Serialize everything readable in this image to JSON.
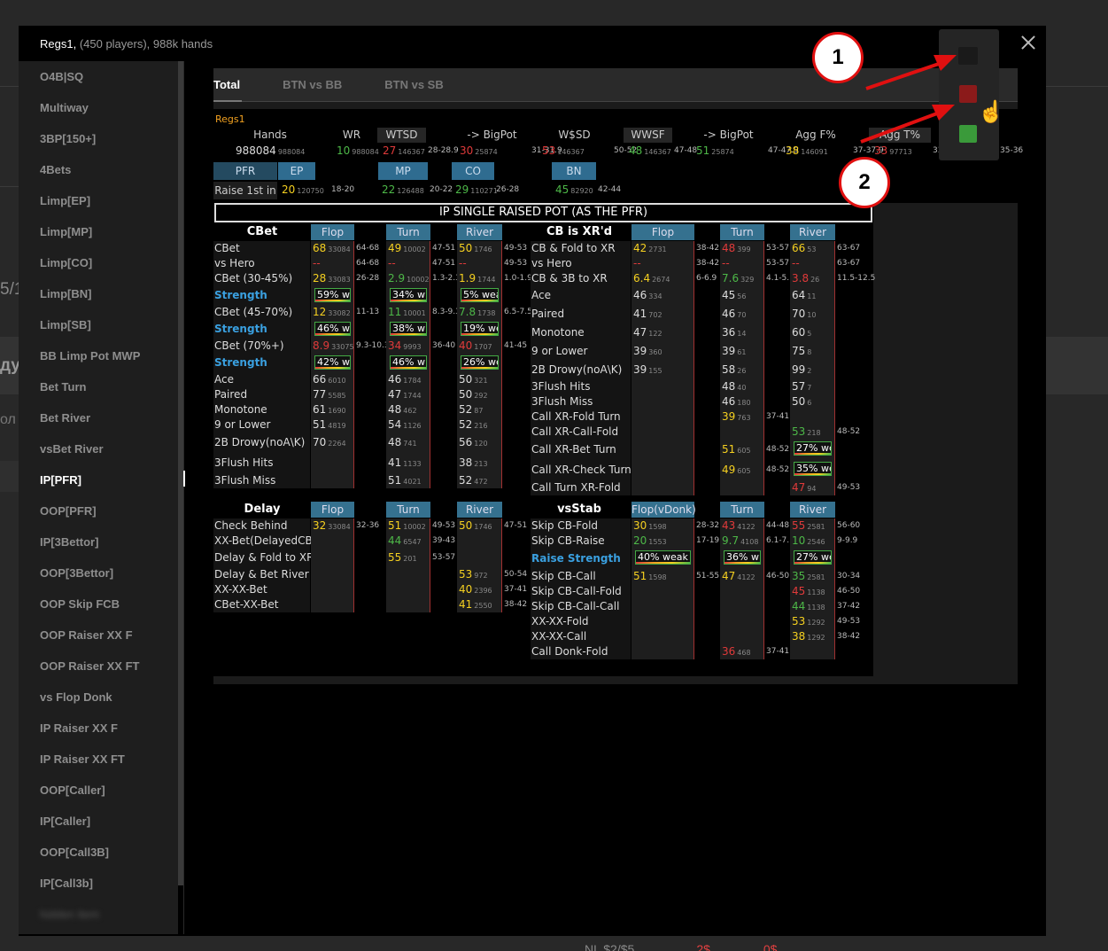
{
  "modal": {
    "title": "Regs1",
    "subtitle": "(450 players), 988k hands"
  },
  "background": {
    "frag1": "5/1",
    "frag2": "дул",
    "frag3": "ол",
    "bottom": "NL $2/$5",
    "bottom2": "2$",
    "bottom3": "0$ ..."
  },
  "sidebar": {
    "items": [
      "O4B|SQ",
      "Multiway",
      "3BP[150+]",
      "4Bets",
      "Limp[EP]",
      "Limp[MP]",
      "Limp[CO]",
      "Limp[BN]",
      "Limp[SB]",
      "BB Limp Pot MWP",
      "Bet Turn",
      "Bet River",
      "vsBet River",
      "IP[PFR]",
      "OOP[PFR]",
      "IP[3Bettor]",
      "OOP[3Bettor]",
      "OOP Skip FCB",
      "OOP Raiser XX F",
      "OOP Raiser XX FT",
      "vs Flop Donk",
      "IP Raiser XX F",
      "IP Raiser XX FT",
      "OOP[Caller]",
      "IP[Caller]",
      "OOP[Call3B]",
      "IP[Call3b]"
    ],
    "active_index": 13,
    "blurred_item": "hidden item"
  },
  "tabs": [
    "Total",
    "BTN vs BB",
    "BTN vs SB"
  ],
  "hud": {
    "player": "Regs1",
    "stats": [
      {
        "label": "Hands",
        "value": "988084",
        "count": "988084",
        "range": ""
      },
      {
        "label": "WR",
        "value": "10",
        "count": "988084",
        "range": ""
      },
      {
        "label": "WTSD",
        "value": "27",
        "count": "146367",
        "range": "28-28.9"
      },
      {
        "label": "-> BigPot",
        "value": "30",
        "count": "25874",
        "range": "31-31.9"
      },
      {
        "label": "W$SD",
        "value": "53",
        "count": "146367",
        "range": "50-52"
      },
      {
        "label": "WWSF",
        "value": "48",
        "count": "146367",
        "range": "47-48"
      },
      {
        "label": "-> BigPot",
        "value": "51",
        "count": "25874",
        "range": "47-47.9"
      },
      {
        "label": "Agg F%",
        "value": "38",
        "count": "146091",
        "range": "37-37.9"
      },
      {
        "label": "Agg T%",
        "value": "33",
        "count": "97713",
        "range": "33-34"
      }
    ],
    "extra_range": "35-36",
    "positions": [
      "PFR",
      "EP",
      "MP",
      "CO",
      "BN"
    ],
    "raise_label": "Raise 1st in",
    "raise": [
      {
        "value": "20",
        "count": "120750",
        "range": "18-20"
      },
      {
        "value": "22",
        "count": "126488",
        "range": "20-22"
      },
      {
        "value": "29",
        "count": "110271",
        "range": "26-28"
      },
      {
        "value": "45",
        "count": "82920",
        "range": "42-44"
      }
    ]
  },
  "grid": {
    "title": "IP SINGLE RAISED POT (AS THE PFR)",
    "left_headers": {
      "title": "CBet",
      "flop": "Flop",
      "turn": "Turn",
      "river": "River"
    },
    "right_headers": {
      "title": "CB is XR'd",
      "flop": "Flop",
      "turn": "Turn",
      "river": "River"
    },
    "left_rows": [
      {
        "label": "CBet",
        "f": [
          "68",
          "33084"
        ],
        "fr": "64-68",
        "t": [
          "49",
          "10002"
        ],
        "tr": "47-51",
        "r": [
          "50",
          "1746"
        ],
        "rr": "49-53"
      },
      {
        "label": "vs Hero",
        "f": [
          "--",
          ""
        ],
        "fr": "64-68",
        "t": [
          "--",
          ""
        ],
        "tr": "47-51",
        "r": [
          "--",
          ""
        ],
        "rr": "49-53"
      },
      {
        "label": "CBet (30-45%)",
        "f": [
          "28",
          "33083"
        ],
        "fr": "26-28",
        "t": [
          "2.9",
          "10002"
        ],
        "tr": "1.3-2.3",
        "r": [
          "1.9",
          "1744"
        ],
        "rr": "1.0-1.9"
      },
      {
        "label": "Strength",
        "f": [
          "59% w",
          ""
        ],
        "fr": "",
        "t": [
          "34% w",
          ""
        ],
        "tr": "",
        "r": [
          "5% wea",
          ""
        ],
        "rr": ""
      },
      {
        "label": "CBet (45-70%)",
        "f": [
          "12",
          "33082"
        ],
        "fr": "11-13",
        "t": [
          "11",
          "10001"
        ],
        "tr": "8.3-9.3",
        "r": [
          "7.8",
          "1738"
        ],
        "rr": "6.5-7.5"
      },
      {
        "label": "Strength",
        "f": [
          "46% w",
          ""
        ],
        "fr": "",
        "t": [
          "38% w",
          ""
        ],
        "tr": "",
        "r": [
          "19% we",
          ""
        ],
        "rr": ""
      },
      {
        "label": "CBet (70%+)",
        "f": [
          "8.9",
          "33075"
        ],
        "fr": "9.3-10.3",
        "t": [
          "34",
          "9993"
        ],
        "tr": "36-40",
        "r": [
          "40",
          "1707"
        ],
        "rr": "41-45"
      },
      {
        "label": "Strength",
        "f": [
          "42% w",
          ""
        ],
        "fr": "",
        "t": [
          "46% w",
          ""
        ],
        "tr": "",
        "r": [
          "26% we",
          ""
        ],
        "rr": ""
      },
      {
        "label": "Ace",
        "f": [
          "66",
          "6010"
        ],
        "fr": "",
        "t": [
          "46",
          "1784"
        ],
        "tr": "",
        "r": [
          "50",
          "321"
        ],
        "rr": ""
      },
      {
        "label": "Paired",
        "f": [
          "77",
          "5585"
        ],
        "fr": "",
        "t": [
          "47",
          "1744"
        ],
        "tr": "",
        "r": [
          "50",
          "292"
        ],
        "rr": ""
      },
      {
        "label": "Monotone",
        "f": [
          "61",
          "1690"
        ],
        "fr": "",
        "t": [
          "48",
          "462"
        ],
        "tr": "",
        "r": [
          "52",
          "87"
        ],
        "rr": ""
      },
      {
        "label": "9 or Lower",
        "f": [
          "51",
          "4819"
        ],
        "fr": "",
        "t": [
          "54",
          "1126"
        ],
        "tr": "",
        "r": [
          "52",
          "216"
        ],
        "rr": ""
      },
      {
        "label": "2B Drowy(noA\\K)",
        "f": [
          "70",
          "2264"
        ],
        "fr": "",
        "t": [
          "48",
          "741"
        ],
        "tr": "",
        "r": [
          "56",
          "120"
        ],
        "rr": ""
      },
      {
        "label": "3Flush Hits",
        "f": [
          "",
          ""
        ],
        "fr": "",
        "t": [
          "41",
          "1133"
        ],
        "tr": "",
        "r": [
          "38",
          "213"
        ],
        "rr": ""
      },
      {
        "label": "3Flush Miss",
        "f": [
          "",
          ""
        ],
        "fr": "",
        "t": [
          "51",
          "4021"
        ],
        "tr": "",
        "r": [
          "52",
          "472"
        ],
        "rr": ""
      }
    ],
    "right_rows": [
      {
        "label": "CB & Fold to XR",
        "f": [
          "42",
          "2731"
        ],
        "fr": "38-42",
        "t": [
          "48",
          "399"
        ],
        "tr": "53-57",
        "r": [
          "66",
          "53"
        ],
        "rr": "63-67"
      },
      {
        "label": "vs Hero",
        "f": [
          "--",
          ""
        ],
        "fr": "38-42",
        "t": [
          "--",
          ""
        ],
        "tr": "53-57",
        "r": [
          "--",
          ""
        ],
        "rr": "63-67"
      },
      {
        "label": "CB & 3B to XR",
        "f": [
          "6.4",
          "2674"
        ],
        "fr": "6-6.9",
        "t": [
          "7.6",
          "329"
        ],
        "tr": "4.1-5.1",
        "r": [
          "3.8",
          "26"
        ],
        "rr": "11.5-12.5"
      },
      {
        "label": "Ace",
        "f": [
          "46",
          "334"
        ],
        "fr": "",
        "t": [
          "45",
          "56"
        ],
        "tr": "",
        "r": [
          "64",
          "11"
        ],
        "rr": ""
      },
      {
        "label": "Paired",
        "f": [
          "41",
          "702"
        ],
        "fr": "",
        "t": [
          "46",
          "70"
        ],
        "tr": "",
        "r": [
          "70",
          "10"
        ],
        "rr": ""
      },
      {
        "label": "Monotone",
        "f": [
          "47",
          "122"
        ],
        "fr": "",
        "t": [
          "36",
          "14"
        ],
        "tr": "",
        "r": [
          "60",
          "5"
        ],
        "rr": ""
      },
      {
        "label": "9 or Lower",
        "f": [
          "39",
          "360"
        ],
        "fr": "",
        "t": [
          "39",
          "61"
        ],
        "tr": "",
        "r": [
          "75",
          "8"
        ],
        "rr": ""
      },
      {
        "label": "2B Drowy(noA\\K)",
        "f": [
          "39",
          "155"
        ],
        "fr": "",
        "t": [
          "58",
          "26"
        ],
        "tr": "",
        "r": [
          "99",
          "2"
        ],
        "rr": ""
      },
      {
        "label": "3Flush Hits",
        "f": [
          "",
          ""
        ],
        "fr": "",
        "t": [
          "48",
          "40"
        ],
        "tr": "",
        "r": [
          "57",
          "7"
        ],
        "rr": ""
      },
      {
        "label": "3Flush Miss",
        "f": [
          "",
          ""
        ],
        "fr": "",
        "t": [
          "46",
          "180"
        ],
        "tr": "",
        "r": [
          "50",
          "6"
        ],
        "rr": ""
      },
      {
        "label": "Call XR-Fold Turn",
        "f": [
          "",
          ""
        ],
        "fr": "",
        "t": [
          "39",
          "763"
        ],
        "tr": "37-41",
        "r": [
          "",
          ""
        ],
        "rr": ""
      },
      {
        "label": "Call XR-Call-Fold",
        "f": [
          "",
          ""
        ],
        "fr": "",
        "t": [
          "",
          ""
        ],
        "tr": "",
        "r": [
          "53",
          "218"
        ],
        "rr": "48-52"
      },
      {
        "label": "Call XR-Bet Turn",
        "f": [
          "",
          ""
        ],
        "fr": "",
        "t": [
          "51",
          "605"
        ],
        "tr": "48-52",
        "r": [
          "27% we",
          ""
        ],
        "rr": ""
      },
      {
        "label": "Call XR-Check Turn",
        "f": [
          "",
          ""
        ],
        "fr": "",
        "t": [
          "49",
          "605"
        ],
        "tr": "48-52",
        "r": [
          "35% we",
          ""
        ],
        "rr": ""
      },
      {
        "label": "Call Turn XR-Fold",
        "f": [
          "",
          ""
        ],
        "fr": "",
        "t": [
          "",
          ""
        ],
        "tr": "",
        "r": [
          "47",
          "94"
        ],
        "rr": "49-53"
      }
    ],
    "delay_headers": {
      "title": "Delay",
      "flop": "Flop",
      "turn": "Turn",
      "river": "River"
    },
    "vsstab_headers": {
      "title": "vsStab",
      "flop": "Flop(vDonk)",
      "turn": "Turn",
      "river": "River"
    },
    "delay_rows": [
      {
        "label": "Check Behind",
        "f": [
          "32",
          "33084"
        ],
        "fr": "32-36",
        "t": [
          "51",
          "10002"
        ],
        "tr": "49-53",
        "r": [
          "50",
          "1746"
        ],
        "rr": "47-51"
      },
      {
        "label": "XX-Bet(DelayedCB)",
        "f": [
          "",
          ""
        ],
        "fr": "",
        "t": [
          "44",
          "6547"
        ],
        "tr": "39-43",
        "r": [
          "",
          ""
        ],
        "rr": ""
      },
      {
        "label": "Delay & Fold to XR",
        "f": [
          "",
          ""
        ],
        "fr": "",
        "t": [
          "55",
          "201"
        ],
        "tr": "53-57",
        "r": [
          "",
          ""
        ],
        "rr": ""
      },
      {
        "label": "Delay & Bet River",
        "f": [
          "",
          ""
        ],
        "fr": "",
        "t": [
          "",
          ""
        ],
        "tr": "",
        "r": [
          "53",
          "972"
        ],
        "rr": "50-54"
      },
      {
        "label": "XX-XX-Bet",
        "f": [
          "",
          ""
        ],
        "fr": "",
        "t": [
          "",
          ""
        ],
        "tr": "",
        "r": [
          "40",
          "2396"
        ],
        "rr": "37-41"
      },
      {
        "label": "CBet-XX-Bet",
        "f": [
          "",
          ""
        ],
        "fr": "",
        "t": [
          "",
          ""
        ],
        "tr": "",
        "r": [
          "41",
          "2550"
        ],
        "rr": "38-42"
      }
    ],
    "vsstab_rows": [
      {
        "label": "Skip CB-Fold",
        "f": [
          "30",
          "1598"
        ],
        "fr": "28-32",
        "t": [
          "43",
          "4122"
        ],
        "tr": "44-48",
        "r": [
          "55",
          "2581"
        ],
        "rr": "56-60"
      },
      {
        "label": "Skip CB-Raise",
        "f": [
          "20",
          "1553"
        ],
        "fr": "17-19",
        "t": [
          "9.7",
          "4108"
        ],
        "tr": "6.1-7.1",
        "r": [
          "10",
          "2546"
        ],
        "rr": "9-9.9"
      },
      {
        "label": "Raise Strength",
        "f": [
          "40% weak",
          ""
        ],
        "fr": "",
        "t": [
          "36% w",
          ""
        ],
        "tr": "",
        "r": [
          "27% we",
          ""
        ],
        "rr": ""
      },
      {
        "label": "Skip CB-Call",
        "f": [
          "51",
          "1598"
        ],
        "fr": "51-55",
        "t": [
          "47",
          "4122"
        ],
        "tr": "46-50",
        "r": [
          "35",
          "2581"
        ],
        "rr": "30-34"
      },
      {
        "label": "Skip CB-Call-Fold",
        "f": [
          "",
          ""
        ],
        "fr": "",
        "t": [
          "",
          ""
        ],
        "tr": "",
        "r": [
          "45",
          "1138"
        ],
        "rr": "46-50"
      },
      {
        "label": "Skip CB-Call-Call",
        "f": [
          "",
          ""
        ],
        "fr": "",
        "t": [
          "",
          ""
        ],
        "tr": "",
        "r": [
          "44",
          "1138"
        ],
        "rr": "37-42"
      },
      {
        "label": "XX-XX-Fold",
        "f": [
          "",
          ""
        ],
        "fr": "",
        "t": [
          "",
          ""
        ],
        "tr": "",
        "r": [
          "53",
          "1292"
        ],
        "rr": "49-53"
      },
      {
        "label": "XX-XX-Call",
        "f": [
          "",
          ""
        ],
        "fr": "",
        "t": [
          "",
          ""
        ],
        "tr": "",
        "r": [
          "38",
          "1292"
        ],
        "rr": "38-42"
      },
      {
        "label": "Call Donk-Fold",
        "f": [
          "",
          ""
        ],
        "fr": "",
        "t": [
          "36",
          "468"
        ],
        "tr": "37-41",
        "r": [
          "",
          ""
        ],
        "rr": ""
      }
    ]
  },
  "popup": {
    "swatches": [
      "dark",
      "red",
      "green"
    ],
    "colors": {
      "dark": "#1a1a1a",
      "red": "#8b1a1a",
      "green": "#3a9a3a"
    }
  },
  "annotations": {
    "badge1": "1",
    "badge2": "2",
    "arrow_color": "#e01010"
  }
}
